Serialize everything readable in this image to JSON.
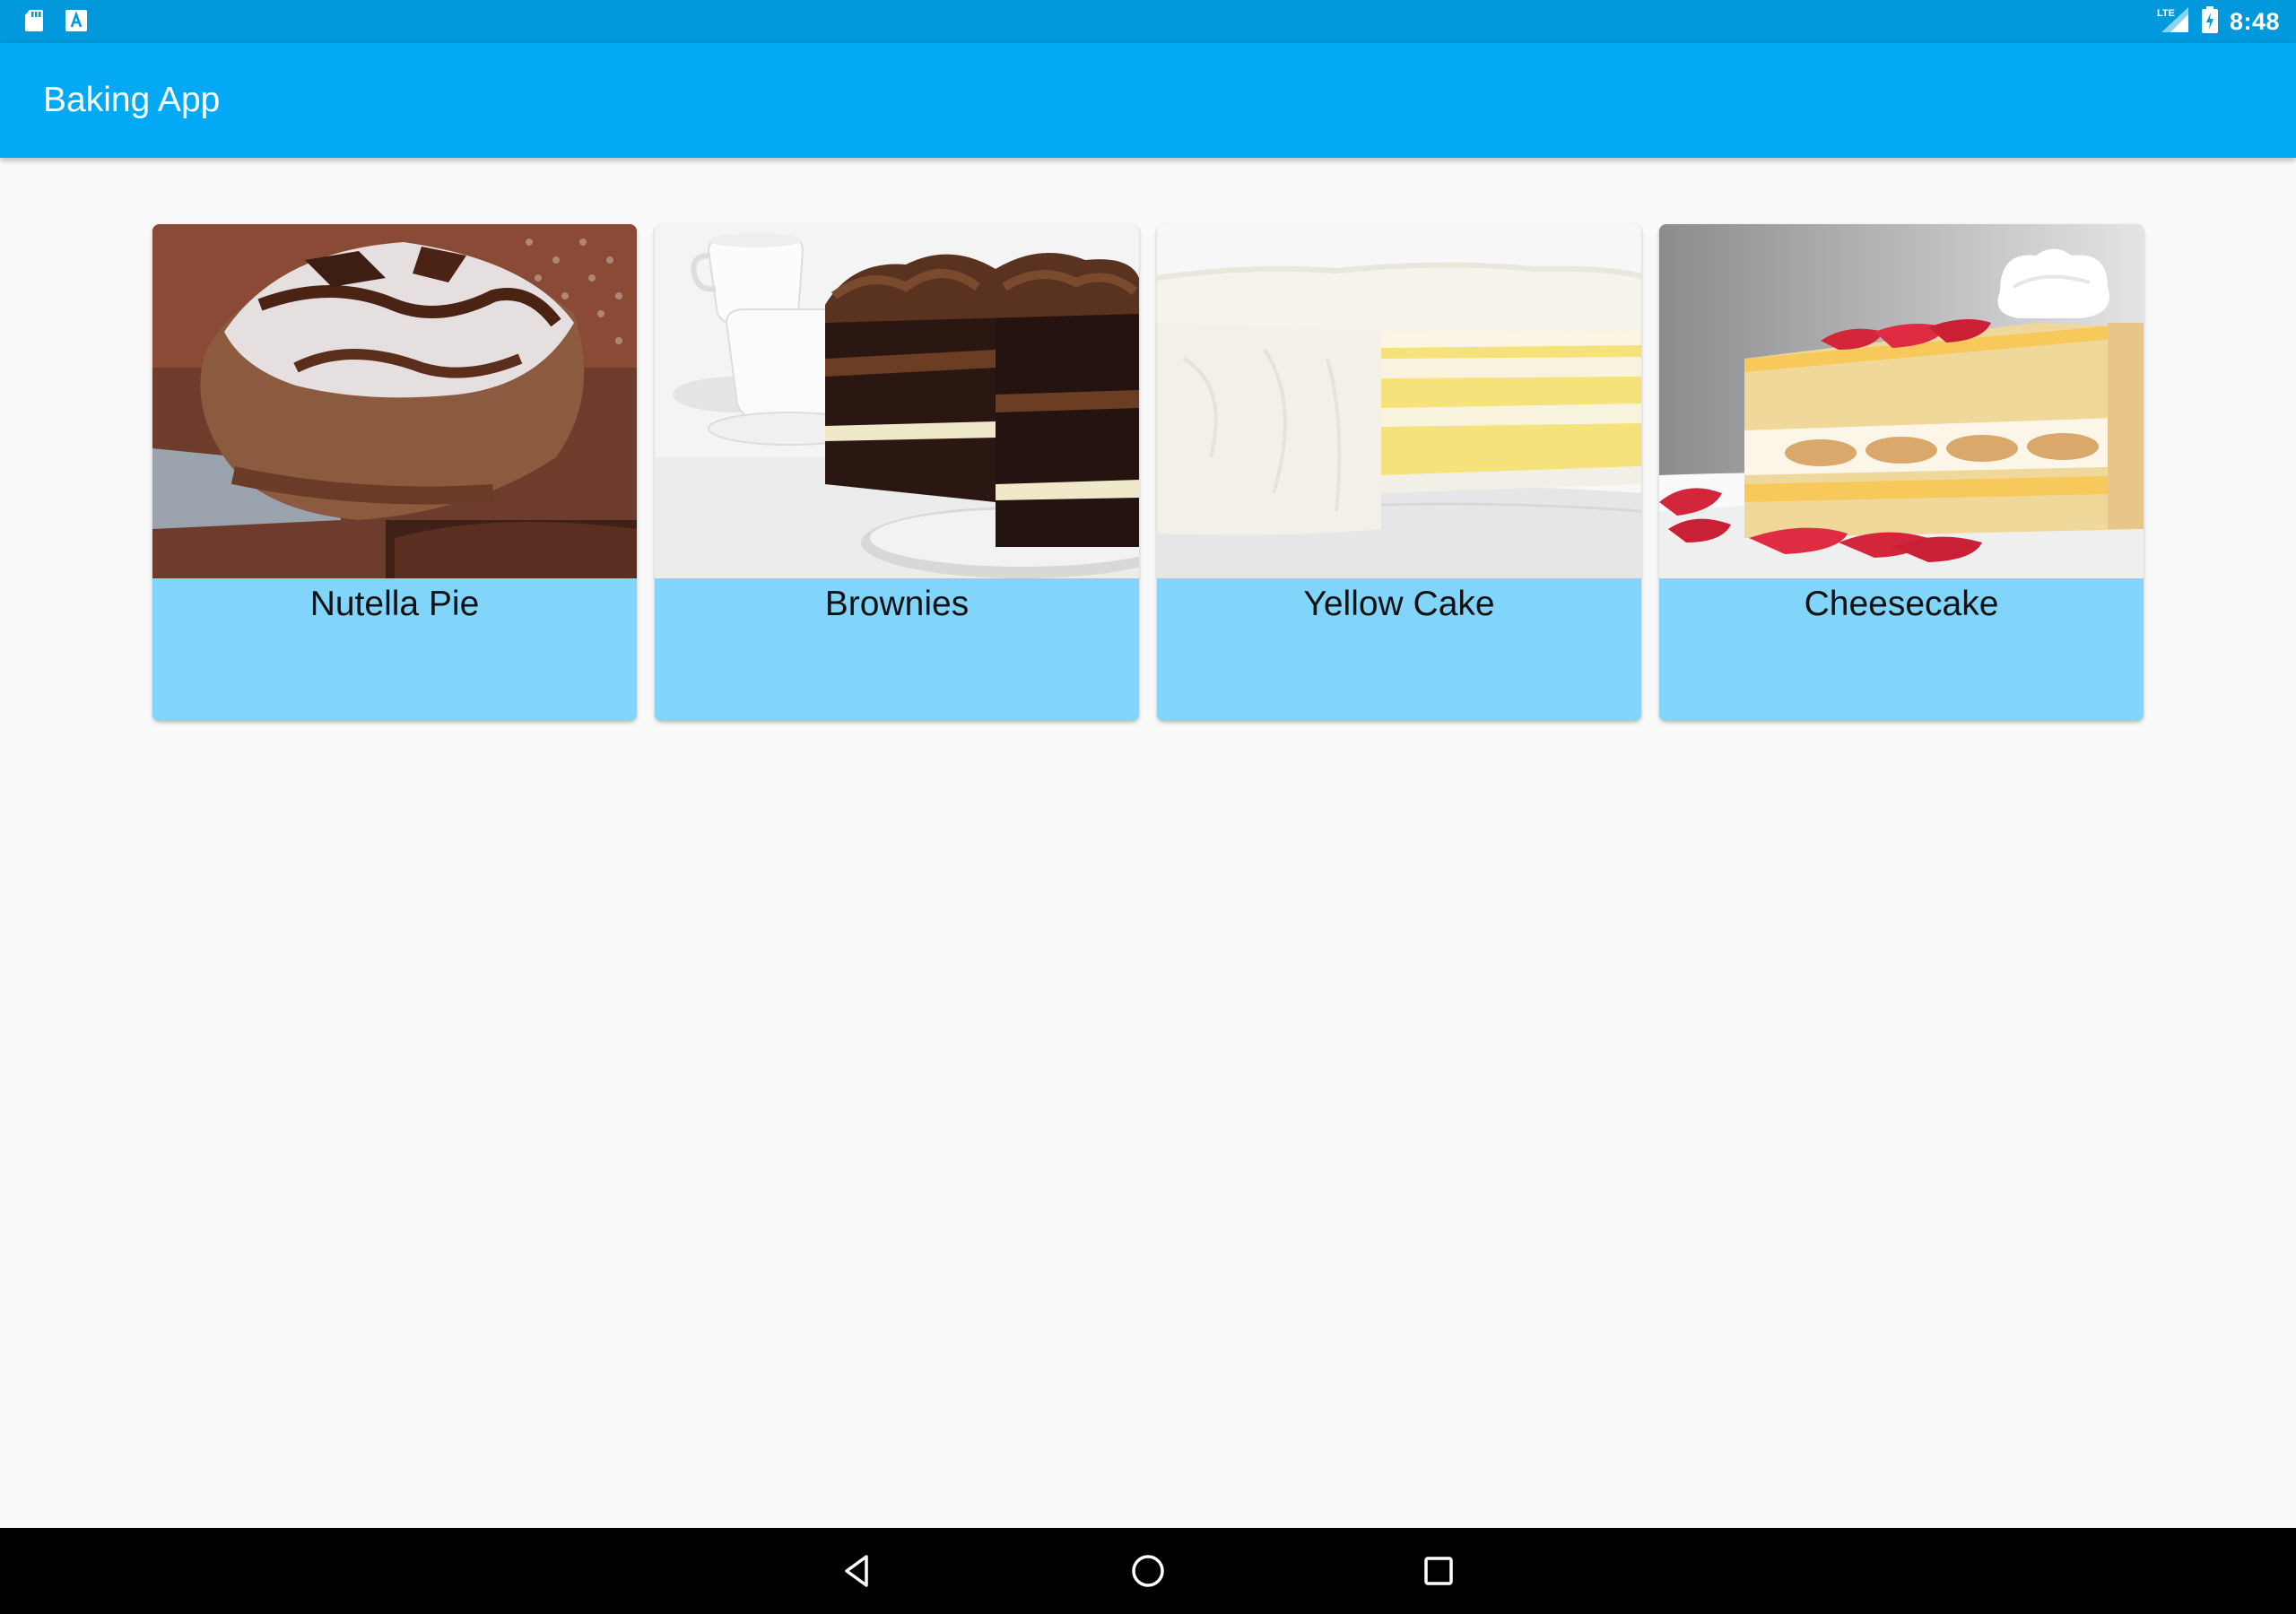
{
  "status_bar": {
    "time": "8:48",
    "icons": [
      "sd-card-icon",
      "font-a-icon",
      "lte-signal-icon",
      "battery-charging-icon"
    ],
    "network_label": "LTE"
  },
  "app_bar": {
    "title": "Baking App"
  },
  "recipes": [
    {
      "name": "Nutella Pie",
      "image": "nutella-pie-photo"
    },
    {
      "name": "Brownies",
      "image": "brownies-photo"
    },
    {
      "name": "Yellow Cake",
      "image": "yellow-cake-photo"
    },
    {
      "name": "Cheesecake",
      "image": "cheesecake-photo"
    }
  ],
  "nav_bar": {
    "buttons": [
      "back",
      "home",
      "recents"
    ]
  },
  "colors": {
    "status_bar": "#0299dc",
    "app_bar": "#03a9f4",
    "card_label_bg": "#81d4fa",
    "background": "#fafafa"
  }
}
